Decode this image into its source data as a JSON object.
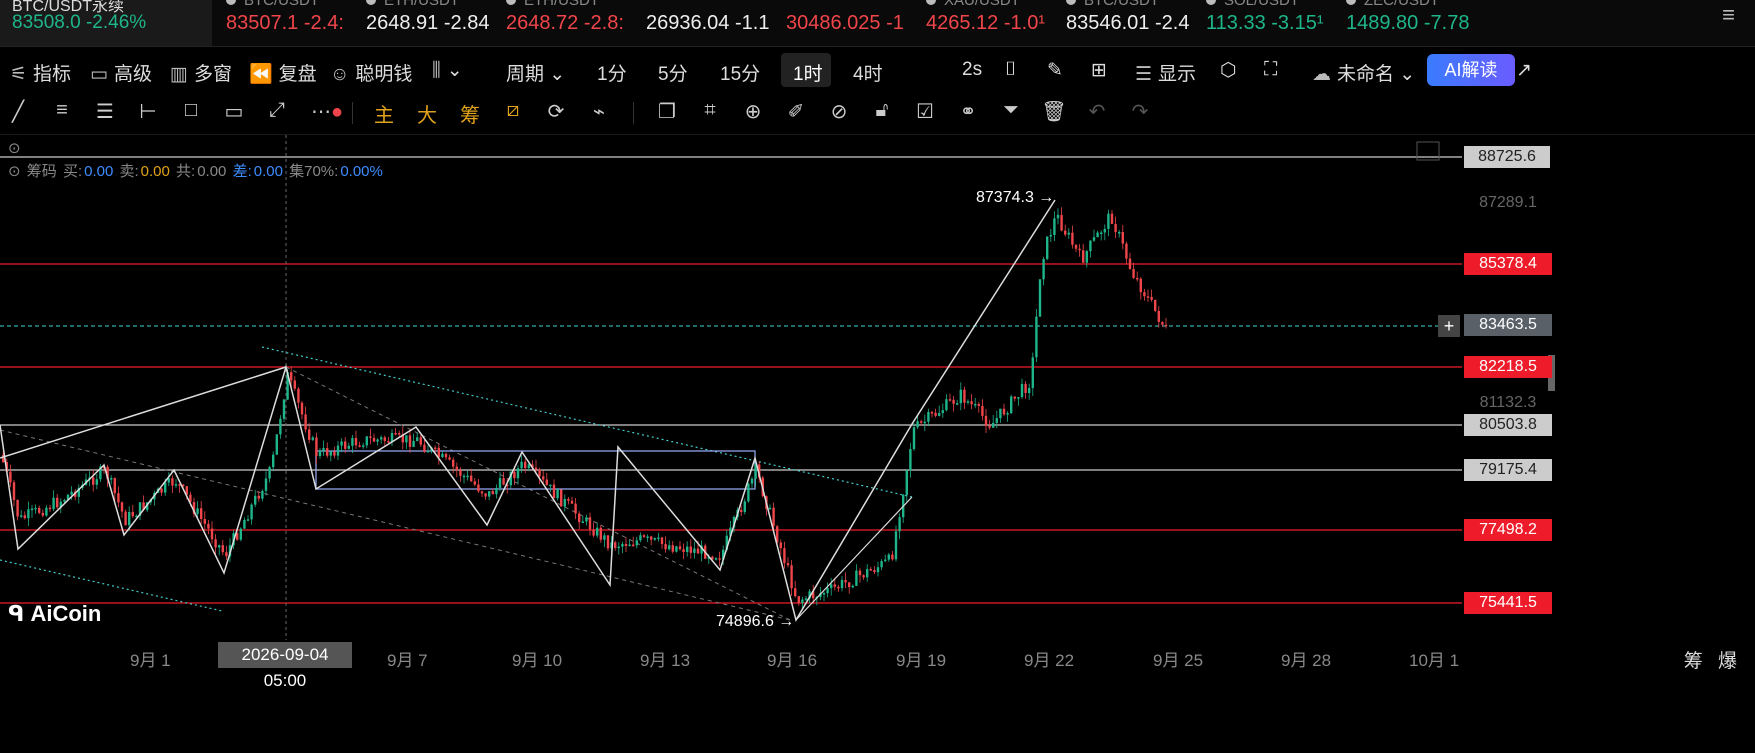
{
  "ticker": [
    {
      "symbol": "BTC/USDT永续",
      "price": "83508.0",
      "change": "-2.46%",
      "color": "green"
    },
    {
      "symbol": "BTC/USDT",
      "price": "83507.1",
      "change": "-2.4:",
      "color": "red"
    },
    {
      "symbol": "ETH/USDT",
      "price": "2648.91",
      "change": "-2.84",
      "color": "white"
    },
    {
      "symbol": "ETH/USDT",
      "price": "2648.72",
      "change": "-2.8:",
      "color": "red"
    },
    {
      "symbol": "",
      "price": "26936.04",
      "change": "-1.1",
      "color": "white"
    },
    {
      "symbol": "",
      "price": "30486.025",
      "change": "-1",
      "color": "red"
    },
    {
      "symbol": "XAU/USDT",
      "price": "4265.12",
      "change": "-1.0¹",
      "color": "red"
    },
    {
      "symbol": "BTC/USDT",
      "price": "83546.01",
      "change": "-2.4",
      "color": "white"
    },
    {
      "symbol": "SOL/USDT",
      "price": "113.33",
      "change": "-3.15¹",
      "color": "green"
    },
    {
      "symbol": "ZEC/USDT",
      "price": "1489.80",
      "change": "-7.78",
      "color": "green"
    }
  ],
  "toolbar": {
    "indicator": "指标",
    "advanced": "高级",
    "multi": "多窗",
    "replay": "复盘",
    "smart": "聪明钱",
    "period": "周期",
    "p1": "1分",
    "p5": "5分",
    "p15": "15分",
    "p1h": "1时",
    "p4h": "4时",
    "refresh": "2s",
    "display": "显示",
    "unnamed": "未命名",
    "ai": "AI解读"
  },
  "drawbar": {
    "main": "主",
    "big": "大",
    "chip": "筹"
  },
  "info": {
    "label": "筹码",
    "buy_l": "买:",
    "buy": "0.00",
    "sell_l": "卖:",
    "sell": "0.00",
    "total_l": "共:",
    "total": "0.00",
    "diff_l": "差:",
    "diff": "0.00",
    "conc_l": "集70%:",
    "conc": "0.00%"
  },
  "price_levels": [
    {
      "label": "88725.6",
      "style": "grey"
    },
    {
      "label": "87289.1",
      "style": "plain"
    },
    {
      "label": "85378.4",
      "style": "red"
    },
    {
      "label": "83463.5",
      "style": "dark"
    },
    {
      "label": "82218.5",
      "style": "red"
    },
    {
      "label": "81132.3",
      "style": "plain"
    },
    {
      "label": "80503.8",
      "style": "grey"
    },
    {
      "label": "79175.4",
      "style": "grey"
    },
    {
      "label": "77498.2",
      "style": "red"
    },
    {
      "label": "75441.5",
      "style": "red"
    }
  ],
  "dates": [
    "9月 1",
    "9月 7",
    "9月 10",
    "9月 13",
    "9月 16",
    "9月 19",
    "9月 22",
    "9月 25",
    "9月 28",
    "10月 1"
  ],
  "crosshair_date": "2026-09-04 05:00",
  "annotations": {
    "high": "87374.3 →",
    "low": "74896.6 →"
  },
  "logo": "AiCoin",
  "corner": {
    "chip": "筹",
    "burst": "爆"
  },
  "colors": {
    "up": "#1fb58a",
    "down": "#f0454a",
    "red_line": "#ee1c2a",
    "grey_line": "#cccccc"
  }
}
